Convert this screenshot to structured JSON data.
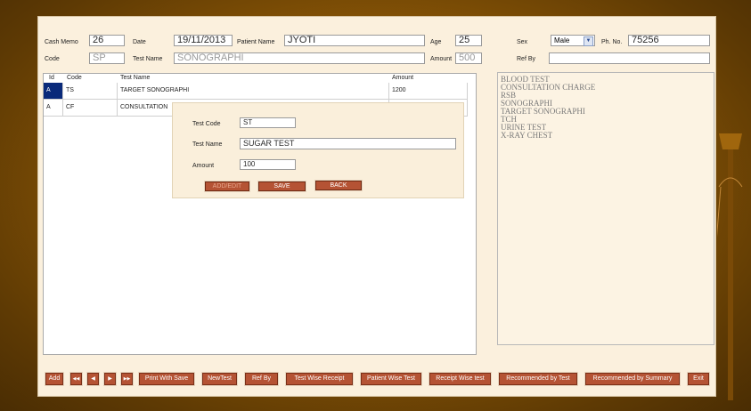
{
  "header": {
    "cash_memo_label": "Cash Memo",
    "cash_memo_value": "26",
    "date_label": "Date",
    "date_value": "19/11/2013",
    "patient_name_label": "Patient Name",
    "patient_name_value": "JYOTI",
    "age_label": "Age",
    "age_value": "25",
    "sex_label": "Sex",
    "sex_value": "Male",
    "phone_label": "Ph. No.",
    "phone_value": "75256",
    "code_label": "Code",
    "code_value": "SP",
    "test_name_label": "Test Name",
    "test_name_value": "SONOGRAPHI",
    "amount_label": "Amount",
    "amount_value": "500",
    "ref_by_label": "Ref By",
    "ref_by_value": ""
  },
  "grid": {
    "columns": [
      "Id",
      "Code",
      "Test Name",
      "Amount"
    ],
    "rows": [
      {
        "id": "A",
        "code": "TS",
        "name": "TARGET SONOGRAPHI",
        "amount": "1200"
      },
      {
        "id": "A",
        "code": "CF",
        "name": "CONSULTATION",
        "amount": ""
      }
    ]
  },
  "dialog": {
    "test_code_label": "Test Code",
    "test_code_value": "ST",
    "test_name_label": "Test Name",
    "test_name_value": "SUGAR TEST",
    "amount_label": "Amount",
    "amount_value": "100",
    "add_edit": "ADD/EDIT",
    "save": "SAVE",
    "back": "BACK"
  },
  "test_list": [
    "BLOOD TEST",
    "CONSULTATION CHARGE",
    "RSB",
    "SONOGRAPHI",
    "TARGET SONOGRAPHI",
    "TCH",
    "URINE TEST",
    "X-RAY CHEST"
  ],
  "toolbar": {
    "add": "Add",
    "first": "◀◀",
    "prev": "◀",
    "next": "▶",
    "last": "▶▶",
    "print_with_save": "Print With Save",
    "new_test": "NewTest",
    "ref_by": "Ref By",
    "test_wise_receipt": "Test Wise Receipt",
    "patient_wise_test": "Patient Wise Test",
    "receipt_wise_test": "Receipt Wise test",
    "recommended_by_test": "Recommended by Test",
    "recommended_by_summary": "Recommended by Summary",
    "exit": "Exit"
  },
  "colors": {
    "background": "#8a5606",
    "window": "#fbf0dd",
    "button": "#b55334",
    "selected_cell": "#0a2a7a"
  }
}
